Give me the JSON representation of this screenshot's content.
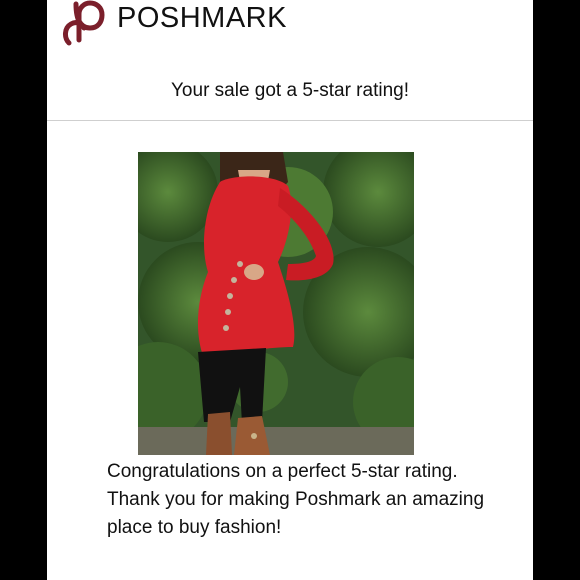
{
  "brand": {
    "name": "POSHMARK",
    "logo_icon": "poshmark-p-logo-icon",
    "logo_color": "#7b1f2b"
  },
  "notification": {
    "headline": "Your sale got a 5-star rating!",
    "message": "Congratulations on a perfect 5-star rating. Thank you for making Poshmark an amazing place to buy fashion!"
  },
  "product_photo": {
    "icon": "product-photo",
    "dress_color": "#d8232b",
    "foliage_color": "#3e6a2e"
  },
  "colors": {
    "background": "#000000",
    "card": "#ffffff",
    "divider": "#cfcfcf",
    "text": "#111111"
  }
}
